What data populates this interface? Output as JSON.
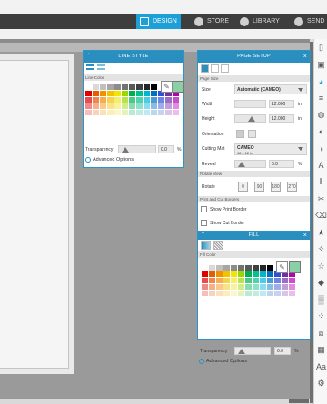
{
  "nav": {
    "tabs": [
      {
        "label": "DESIGN",
        "active": true
      },
      {
        "label": "STORE",
        "active": false
      },
      {
        "label": "LIBRARY",
        "active": false
      },
      {
        "label": "SEND",
        "active": false
      }
    ],
    "accent": "#1d9fd8"
  },
  "line_style": {
    "title": "LINE STYLE",
    "section": "Line Color",
    "transparency_label": "Transparency",
    "transparency_value": "0.0",
    "transparency_unit": "%",
    "advanced": "Advanced Options",
    "selected_color": "#8ad0a4"
  },
  "page_setup": {
    "title": "PAGE SETUP",
    "section_page_size": "Page Size",
    "size_label": "Size",
    "size_value": "Automatic (CAMEO)",
    "width_label": "Width",
    "width_value": "12.000",
    "width_unit": "in",
    "height_label": "Height",
    "height_value": "12.000",
    "height_unit": "in",
    "orientation_label": "Orientation",
    "cutting_mat_label": "Cutting Mat",
    "cutting_mat_value": "CAMEO",
    "cutting_mat_sub": "12 x 12 in",
    "reveal_label": "Reveal",
    "reveal_value": "0.0",
    "reveal_unit": "%",
    "section_rotate": "Rotate View",
    "rotate_label": "Rotate",
    "rotate_options": [
      "0",
      "90",
      "180",
      "270"
    ],
    "section_print": "Print and Cut Borders",
    "show_print_border": "Show Print Border",
    "show_cut_border": "Show Cut Border"
  },
  "fill": {
    "title": "FILL",
    "section": "Fill Color",
    "transparency_label": "Transparency",
    "transparency_value": "0.0",
    "transparency_unit": "%",
    "advanced": "Advanced Options",
    "selected_color": "#8ad0a4"
  },
  "palette": [
    "#ffffff",
    "#d9d9d9",
    "#bfbfbf",
    "#a6a6a6",
    "#8c8c8c",
    "#737373",
    "#595959",
    "#404040",
    "#262626",
    "#000000",
    "#ffffff",
    "#ffffff",
    "#ffffff",
    "#e00000",
    "#e65c00",
    "#f29100",
    "#f2c200",
    "#f2e600",
    "#9ad600",
    "#00b050",
    "#00c28c",
    "#00b5cc",
    "#0070c0",
    "#2e4fd9",
    "#7030a0",
    "#b300b3",
    "#e84d4d",
    "#f0854d",
    "#f5ad4d",
    "#f5d34d",
    "#f5ee66",
    "#b9e34d",
    "#4dc984",
    "#4dd4ae",
    "#4dcbe0",
    "#4d9bd6",
    "#6d85e4",
    "#9c6dc0",
    "#cc4dcc",
    "#f08a8a",
    "#f5b08a",
    "#f8c98a",
    "#f8e38a",
    "#f8f29c",
    "#d2ec8a",
    "#8adbad",
    "#8ae2c9",
    "#8adced",
    "#8abbe4",
    "#9eade9",
    "#bea0d6",
    "#e08ae0",
    "#f7bcbc",
    "#f9d2bc",
    "#fbe0bc",
    "#fbeebc",
    "#fbf7c6",
    "#e4f3bc",
    "#bce9cf",
    "#bcede0",
    "#bce9f4",
    "#bcd6ef",
    "#c8d1f1",
    "#d9c6e7",
    "#ecbcec"
  ],
  "toolbar_icons": [
    "document-icon",
    "image-icon",
    "color-icon",
    "line-icon",
    "shadow-icon",
    "fill-icon",
    "half-icon",
    "text-icon",
    "cut-icon",
    "scissors-icon",
    "eraser-icon",
    "star-icon",
    "sparkle-icon",
    "outline-star-icon",
    "rhinestone-icon",
    "pattern-icon",
    "dots-icon",
    "puzzle-icon",
    "grid-icon",
    "text-style-icon",
    "gear-icon"
  ]
}
